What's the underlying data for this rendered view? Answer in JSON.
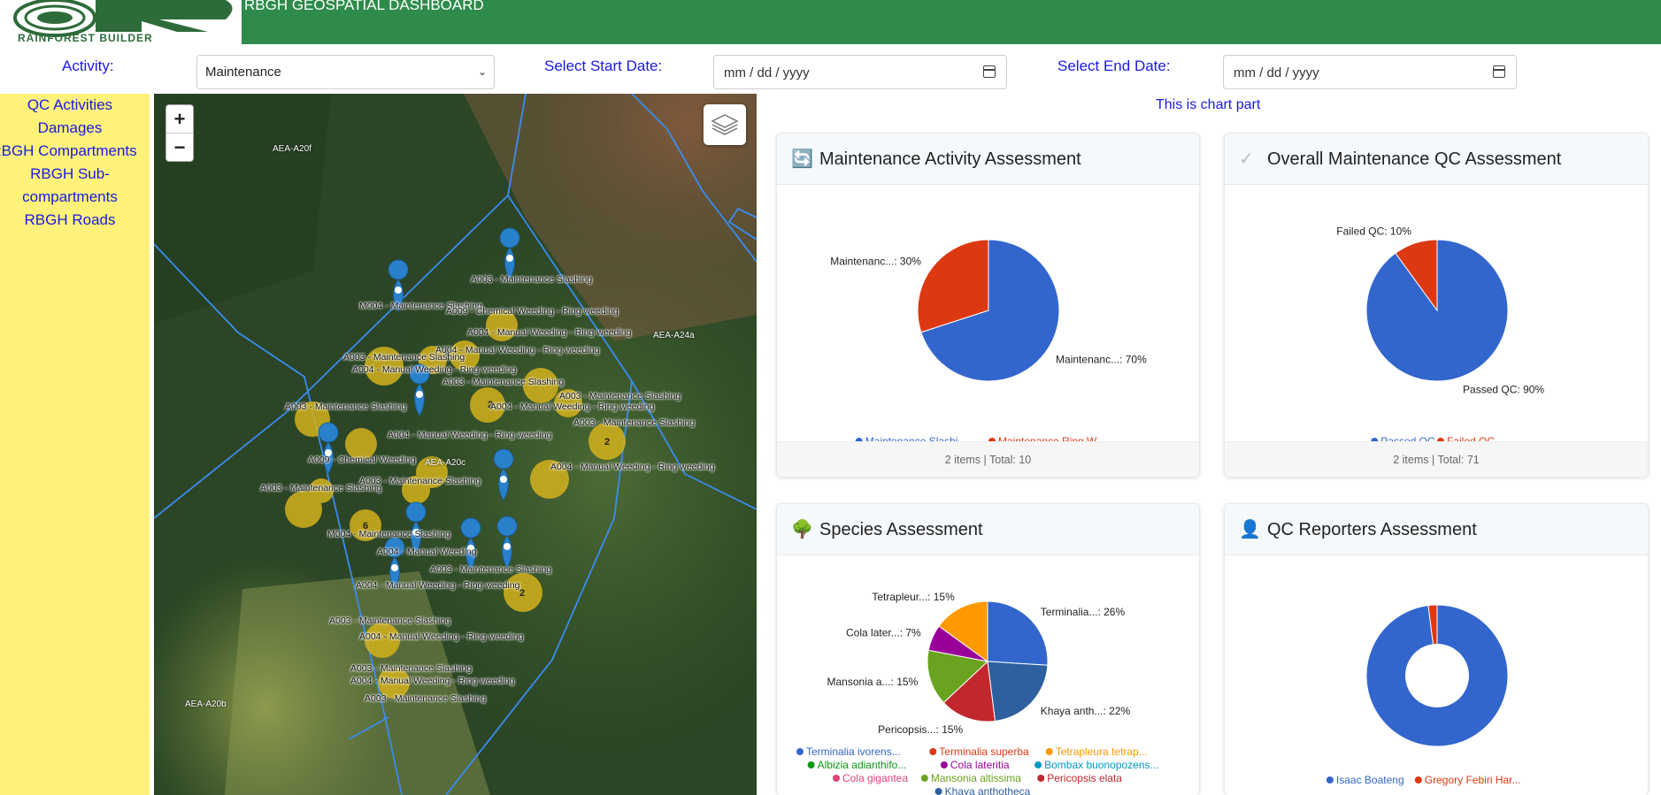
{
  "header": {
    "title": "RBGH GEOSPATIAL DASHBOARD",
    "logo_text": "RAINFOREST BUILDER"
  },
  "filters": {
    "activity_label": "Activity:",
    "activity_value": "Maintenance",
    "start_label": "Select Start Date:",
    "start_placeholder": "mm / dd / yyyy",
    "end_label": "Select End Date:",
    "end_placeholder": "mm / dd / yyyy"
  },
  "sidebar": {
    "items": [
      "QC Activities",
      "Damages",
      "RBGH Compartments",
      "RBGH Sub-",
      "compartments",
      "RBGH Roads"
    ]
  },
  "map": {
    "zoom_in": "+",
    "zoom_out": "−",
    "area_labels": [
      "AEA-A20f",
      "AEA-A24a",
      "AEA-A20c",
      "AEA-A20b"
    ],
    "marker_labels": [
      "A003 - Maintenance Slashing",
      "M004 - Maintenance Slashing",
      "A009 - Chemical Weeding - Ring weeding",
      "A004 - Manual Weeding - Ring weeding",
      "A004 - Manual Weeding - Ring weeding",
      "A003 - Maintenance Slashing",
      "A004 - Manual Weeding - Ring weeding",
      "A003 - Maintenance Slashing",
      "A003 - Maintenance Slashing",
      "A003 - Maintenance Slashing",
      "A004 - Manual Weeding - Ring weeding",
      "A004 - Manual Weeding - Ring weeding",
      "A003 - Maintenance Slashing",
      "A009 - Chemical Weeding",
      "A003 - Maintenance Slashing",
      "A004 - Manual Weeding - Ring weeding",
      "A003 - Maintenance Slashing",
      "M004 - Maintenance Slashing",
      "A004 - Manual Weeding",
      "A003 - Maintenance Slashing",
      "A004 - Manual Weeding - Ring weeding",
      "A003 - Maintenance Slashing",
      "A004 - Manual Weeding - Ring weeding",
      "A003 - Maintenance Slashing",
      "A004 - Manual Weeding - Ring weeding",
      "A003 - Maintenance Slashing"
    ],
    "cluster_counts": [
      "2",
      "6",
      "2"
    ]
  },
  "panel": {
    "heading": "This is chart part"
  },
  "cards": {
    "maintenance": {
      "title": "Maintenance Activity Assessment",
      "footer": "2 items | Total: 10"
    },
    "qc": {
      "title": "Overall Maintenance QC Assessment",
      "footer": "2 items | Total: 71"
    },
    "species": {
      "title": "Species Assessment"
    },
    "reporters": {
      "title": "QC Reporters Assessment"
    }
  },
  "chart_data": [
    {
      "type": "pie",
      "slices": [
        {
          "label": "Maintenanc...: 70%",
          "value": 70,
          "color": "#3366cc",
          "legend": "Maintenance Slashi..."
        },
        {
          "label": "Maintenanc...: 30%",
          "value": 30,
          "color": "#dc3912",
          "legend": "Maintenance Ring W..."
        }
      ]
    },
    {
      "type": "pie",
      "slices": [
        {
          "label": "Passed QC: 90%",
          "value": 90,
          "color": "#3366cc",
          "legend": "Passed QC"
        },
        {
          "label": "Failed QC: 10%",
          "value": 10,
          "color": "#dc3912",
          "legend": "Failed QC"
        }
      ]
    },
    {
      "type": "pie",
      "slices": [
        {
          "label": "Terminalia...: 26%",
          "value": 26,
          "color": "#3366cc",
          "legend": "Terminalia ivorens..."
        },
        {
          "label": "Khaya anth...: 22%",
          "value": 22,
          "color": "#2e5f9e",
          "legend": "Khaya anthotheca"
        },
        {
          "label": "Pericopsis...: 15%",
          "value": 15,
          "color": "#c2272d",
          "legend": "Pericopsis elata"
        },
        {
          "label": "Mansonia a...: 15%",
          "value": 15,
          "color": "#6aa31f",
          "legend": "Mansonia altissima"
        },
        {
          "label": "Cola later...: 7%",
          "value": 7,
          "color": "#990099",
          "legend": "Cola lateritia"
        },
        {
          "label": "Tetrapleur...: 15%",
          "value": 15,
          "color": "#ff9900",
          "legend": "Tetrapleura tetrap..."
        }
      ],
      "legend_extra": [
        {
          "legend": "Terminalia superba",
          "color": "#dc3912"
        },
        {
          "legend": "Albizia adianthifo...",
          "color": "#109618"
        },
        {
          "legend": "Bombax buonopozens...",
          "color": "#0099c6"
        },
        {
          "legend": "Cola gigantea",
          "color": "#dd4477"
        }
      ]
    },
    {
      "type": "pie",
      "donut": true,
      "slices": [
        {
          "value": 98,
          "color": "#3366cc",
          "legend": "Isaac Boateng"
        },
        {
          "value": 2,
          "color": "#dc3912",
          "legend": "Gregory Febiri Har..."
        }
      ]
    }
  ]
}
